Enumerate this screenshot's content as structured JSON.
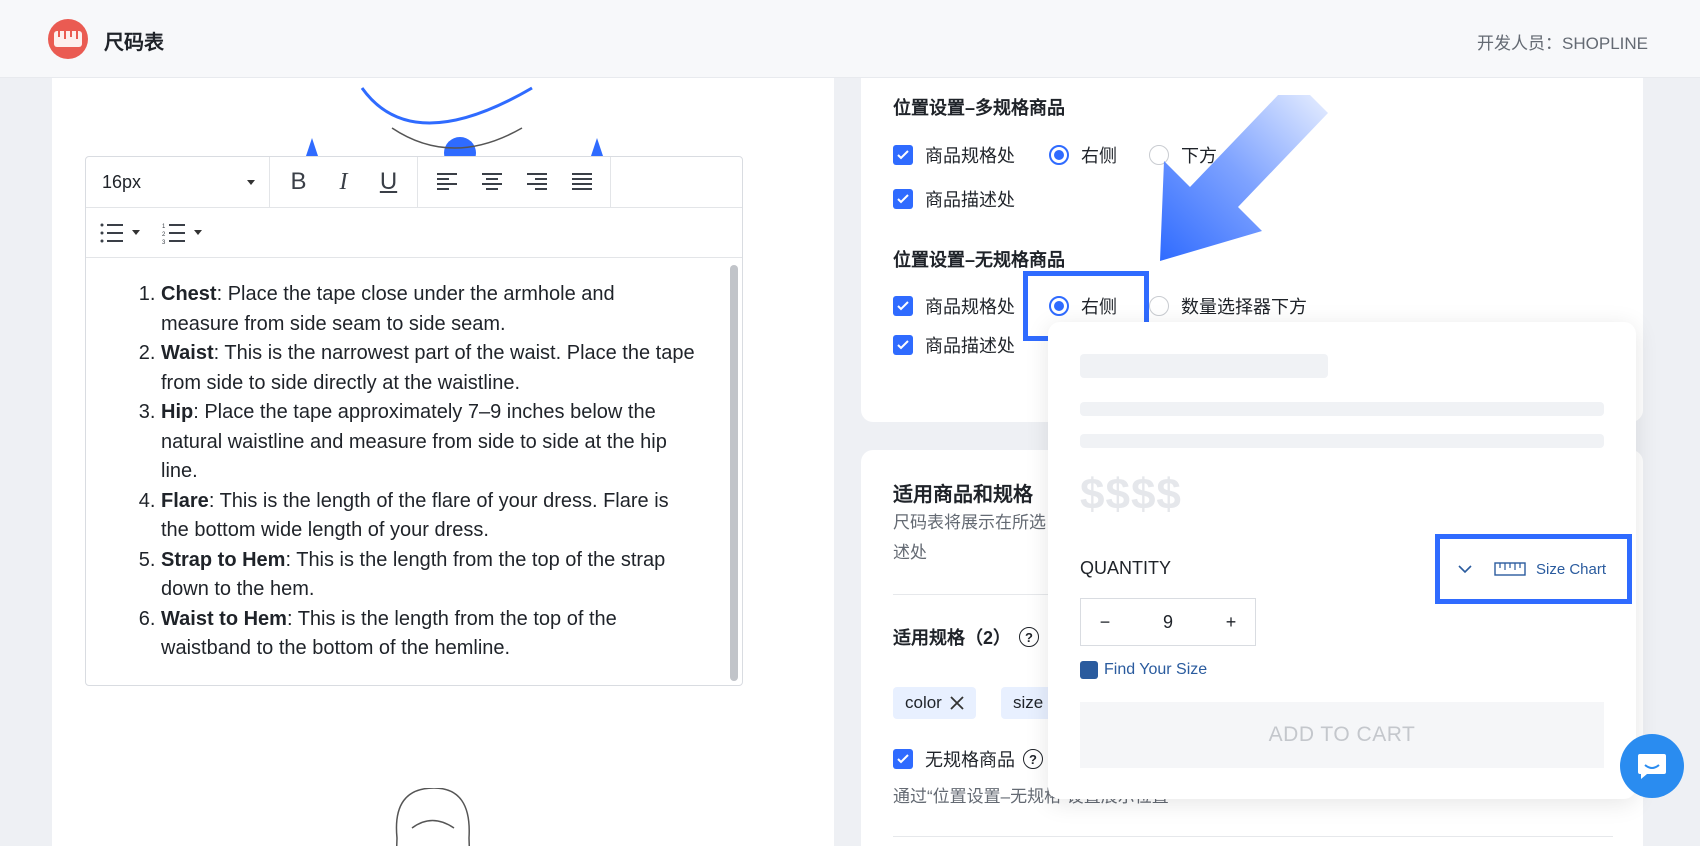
{
  "header": {
    "app_title": "尺码表",
    "developer": "开发人员：SHOPLINE"
  },
  "editor": {
    "font_size": "16px",
    "toolbar": {
      "bold": "B",
      "italic": "I",
      "underline": "U"
    },
    "items": [
      {
        "bold": "Chest",
        "text": ": Place the tape close under the armhole and measure from side seam to side seam."
      },
      {
        "bold": "Waist",
        "text": ": This is the narrowest part of the waist. Place the tape from side to side directly at the waistline."
      },
      {
        "bold": "Hip",
        "text": ": Place the tape approximately 7–9 inches below the natural waistline and measure from side to side at the hip line."
      },
      {
        "bold": "Flare",
        "text": ": This is the length of the flare of your dress. Flare is the bottom wide length of your dress."
      },
      {
        "bold": "Strap to Hem",
        "text": ": This is the length from the top of the strap down to the hem."
      },
      {
        "bold": "Waist to Hem",
        "text": ": This is the length from the top of the waistband to the bottom of the hemline."
      }
    ]
  },
  "position_multi": {
    "title": "位置设置–多规格商品",
    "spec_checkbox": "商品规格处",
    "right_option": "右侧",
    "below_option": "下方",
    "desc_checkbox": "商品描述处"
  },
  "position_single": {
    "title": "位置设置–无规格商品",
    "spec_checkbox": "商品规格处",
    "right_option": "右侧",
    "below_qty_option": "数量选择器下方",
    "desc_checkbox": "商品描述处"
  },
  "applicable": {
    "title": "适用商品和规格",
    "desc_line1": "尺码表将展示在所选",
    "desc_line2": "述处",
    "specs_label": "适用规格（2）",
    "tags": [
      "color",
      "size"
    ],
    "no_spec_label": "无规格商品",
    "bottom_note": "通过“位置设置–无规格”设置展示位置"
  },
  "preview": {
    "price": "$$$$",
    "quantity_label": "QUANTITY",
    "quantity_value": "9",
    "minus": "−",
    "plus": "+",
    "find_size": "Find Your Size",
    "add_to_cart": "ADD TO CART",
    "size_chart": "Size Chart"
  },
  "colors": {
    "accent": "#2f6bff",
    "logo": "#ea5b52",
    "chat": "#2a8cf0"
  }
}
